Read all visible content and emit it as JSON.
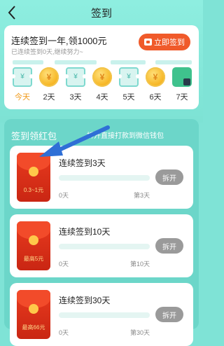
{
  "header": {
    "title": "签到"
  },
  "card": {
    "title": "连续签到一年,领1000元",
    "subtitle": "已连续签到0天,继续努力~",
    "sign_button": "立即签到",
    "days": [
      {
        "label": "今天",
        "reward": "ticket",
        "glyph": "¥",
        "today": true
      },
      {
        "label": "2天",
        "reward": "coin",
        "glyph": "¥"
      },
      {
        "label": "3天",
        "reward": "ticket",
        "glyph": "¥"
      },
      {
        "label": "4天",
        "reward": "coin",
        "glyph": "¥"
      },
      {
        "label": "5天",
        "reward": "ticket",
        "glyph": "¥"
      },
      {
        "label": "6天",
        "reward": "coin",
        "glyph": "¥"
      },
      {
        "label": "7天",
        "reward": "puzzle",
        "glyph": ""
      }
    ]
  },
  "section": {
    "title": "签到领红包",
    "note": "拆开直接打款到微信钱包",
    "items": [
      {
        "title": "连续签到3天",
        "amount": "0.3~1元",
        "start": "0天",
        "end": "第3天",
        "button": "拆开"
      },
      {
        "title": "连续签到10天",
        "amount": "最高5元",
        "start": "0天",
        "end": "第10天",
        "button": "拆开"
      },
      {
        "title": "连续签到30天",
        "amount": "最高66元",
        "start": "0天",
        "end": "第30天",
        "button": "拆开"
      }
    ]
  },
  "colors": {
    "accent": "#f05a2a",
    "teal": "#6cd6c9",
    "coin": "#f7b92a",
    "arrow": "#2f6fd6"
  }
}
